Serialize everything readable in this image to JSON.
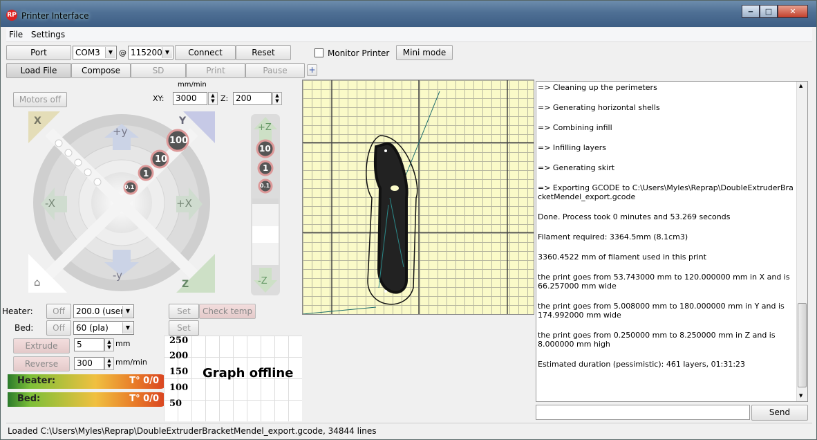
{
  "window": {
    "title": "Printer Interface",
    "app_icon": "RP"
  },
  "menu": {
    "items": [
      "File",
      "Settings"
    ]
  },
  "toolbar": {
    "port_label": "Port",
    "port_value": "COM3",
    "at": "@",
    "baud_value": "115200",
    "connect_label": "Connect",
    "reset_label": "Reset",
    "monitor_label": "Monitor Printer",
    "mini_mode_label": "Mini mode",
    "load_file_label": "Load File",
    "compose_label": "Compose",
    "sd_label": "SD",
    "print_label": "Print",
    "pause_label": "Pause",
    "plus_label": "+"
  },
  "motion": {
    "motors_off_label": "Motors off",
    "speed_unit": "mm/min",
    "xy_label": "XY:",
    "xy_value": "3000",
    "z_label": "Z:",
    "z_value": "200",
    "jog_labels": {
      "x_home": "X",
      "y_home": "Y",
      "z_home": "Z",
      "plus_y": "+y",
      "minus_y": "-y",
      "plus_x": "+X",
      "minus_x": "-X",
      "plus_z": "+Z",
      "minus_z": "-Z"
    },
    "steps": [
      "100",
      "10",
      "1",
      "0.1"
    ],
    "z_steps": [
      "10",
      "1",
      "0.1"
    ]
  },
  "temps": {
    "heater_label": "Heater:",
    "heater_btn": "Off",
    "heater_value": "200.0 (user",
    "bed_label": "Bed:",
    "bed_btn": "Off",
    "bed_value": "60 (pla)",
    "set_label": "Set",
    "check_temp_label": "Check temp"
  },
  "extrude": {
    "extrude_label": "Extrude",
    "extrude_value": "5",
    "extrude_unit": "mm",
    "reverse_label": "Reverse",
    "reverse_value": "300",
    "reverse_unit": "mm/min"
  },
  "gauges": {
    "heater_name": "Heater:",
    "heater_temp": "T° 0/0",
    "bed_name": "Bed:",
    "bed_temp": "T° 0/0"
  },
  "graph": {
    "status": "Graph offline",
    "ticks": [
      "250",
      "200",
      "150",
      "100",
      "50"
    ]
  },
  "log": {
    "lines": [
      "=> Cleaning up the perimeters",
      "=> Generating horizontal shells",
      "=> Combining infill",
      "=> Infilling layers",
      "=> Generating skirt",
      "=> Exporting GCODE to C:\\Users\\Myles\\Reprap\\DoubleExtruderBracketMendel_export.gcode",
      "Done. Process took 0 minutes and 53.269 seconds",
      "Filament required: 3364.5mm (8.1cm3)",
      "3360.4522 mm of filament used in this print",
      "the print goes from 53.743000 mm to 120.000000 mm in X and is 66.257000 mm wide",
      "the print goes from 5.008000 mm to 180.000000 mm in Y and is 174.992000 mm wide",
      "the print goes from 0.250000 mm to 8.250000 mm in Z and is 8.000000 mm high",
      "Estimated duration (pessimistic):  461 layers, 01:31:23"
    ],
    "send_label": "Send"
  },
  "status": {
    "text": "Loaded C:\\Users\\Myles\\Reprap\\DoubleExtruderBracketMendel_export.gcode, 34844 lines"
  },
  "colors": {
    "plate_bg": "#fafac8",
    "accent_red": "#d84020"
  }
}
